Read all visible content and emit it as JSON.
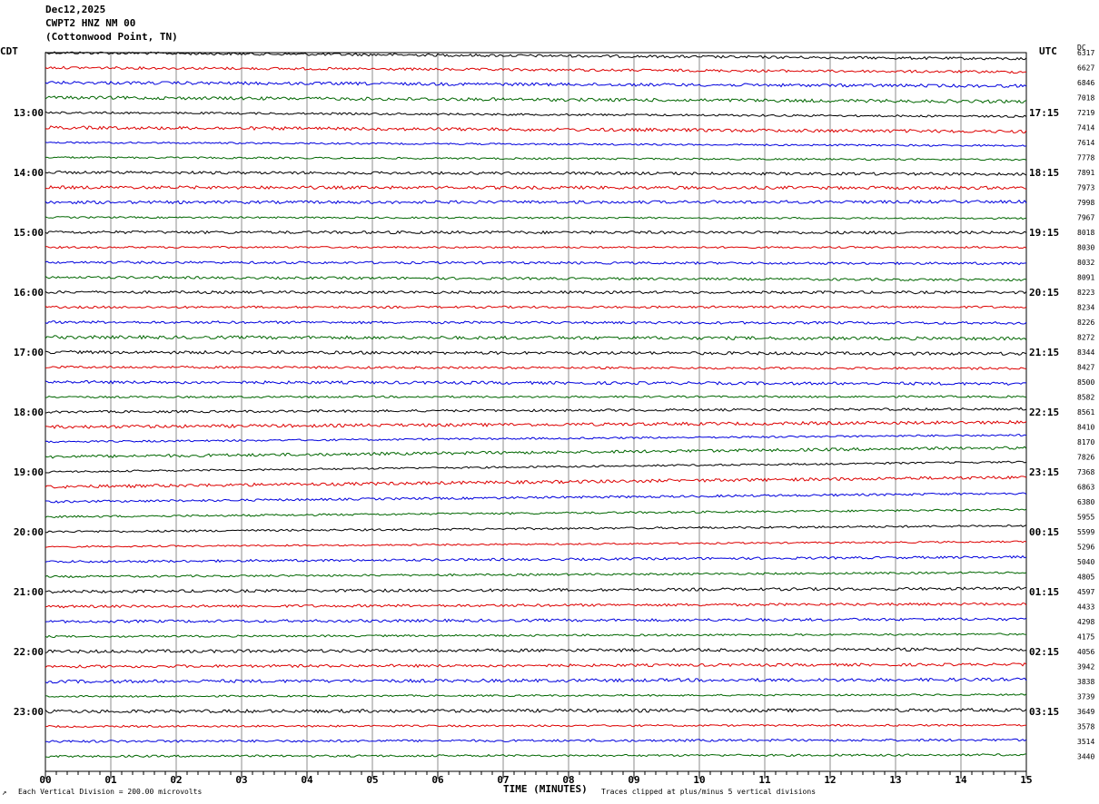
{
  "header": {
    "date": "Dec12,2025",
    "station": "CWPT2 HNZ NM 00",
    "location": "(Cottonwood Point, TN)"
  },
  "timezones": {
    "left": "CDT",
    "right": "UTC"
  },
  "dc_label": "DC",
  "footer": {
    "scale_note": "Each Vertical Division = 200.00 microvolts",
    "xaxis_title": "TIME (MINUTES)",
    "clip_note": "Traces clipped at plus/minus 5 vertical divisions",
    "corner_mark": "↗"
  },
  "colors": {
    "trace_cycle": [
      "#000000",
      "#dd0000",
      "#0000dd",
      "#006600"
    ],
    "grid": "#8c8c8c"
  },
  "chart_data": {
    "type": "line",
    "title": "",
    "xlabel": "TIME (MINUTES)",
    "xlim": [
      0,
      15
    ],
    "x_tick_labels": [
      "00",
      "01",
      "02",
      "03",
      "04",
      "05",
      "06",
      "07",
      "08",
      "09",
      "10",
      "11",
      "12",
      "13",
      "14",
      "15"
    ],
    "left_hour_labels": [
      "13:00",
      "14:00",
      "15:00",
      "16:00",
      "17:00",
      "18:00",
      "19:00",
      "20:00",
      "21:00",
      "22:00",
      "23:00"
    ],
    "right_hour_labels": [
      "17:15",
      "18:15",
      "19:15",
      "20:15",
      "21:15",
      "22:15",
      "23:15",
      "00:15",
      "01:15",
      "02:15",
      "03:15"
    ],
    "dc_offsets": [
      6317,
      6627,
      6846,
      7018,
      7219,
      7414,
      7614,
      7778,
      7891,
      7973,
      7998,
      7967,
      8018,
      8030,
      8032,
      8091,
      8223,
      8234,
      8226,
      8272,
      8344,
      8427,
      8500,
      8582,
      8561,
      8410,
      8170,
      7826,
      7368,
      6863,
      6380,
      5955,
      5599,
      5296,
      5040,
      4805,
      4597,
      4433,
      4298,
      4175,
      4056,
      3942,
      3838,
      3739,
      3649,
      3578,
      3514,
      3440
    ],
    "trace_count": 48
  }
}
